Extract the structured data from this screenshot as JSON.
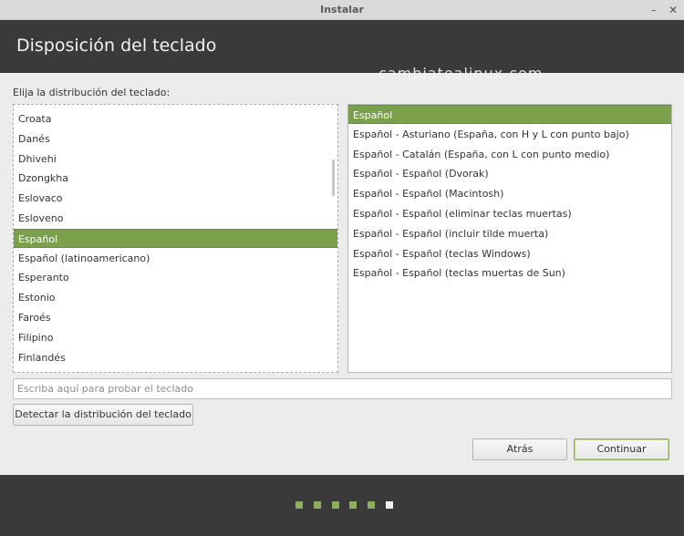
{
  "window": {
    "title": "Instalar",
    "minimize": "–",
    "close": "✕"
  },
  "header": {
    "heading": "Disposición del teclado"
  },
  "watermark": "cambiatealinux.com",
  "prompt": "Elija la distribución del teclado:",
  "layouts": {
    "items": [
      "Croata",
      "Danés",
      "Dhivehi",
      "Dzongkha",
      "Eslovaco",
      "Esloveno",
      "Español",
      "Español (latinoamericano)",
      "Esperanto",
      "Estonio",
      "Faroés",
      "Filipino",
      "Finlandés"
    ],
    "selected": "Español"
  },
  "variants": {
    "items": [
      "Español",
      "Español - Asturiano (España, con H y L con punto bajo)",
      "Español - Catalán (España, con L con punto medio)",
      "Español - Español (Dvorak)",
      "Español - Español (Macintosh)",
      "Español - Español (eliminar teclas muertas)",
      "Español - Español (incluir tilde muerta)",
      "Español - Español (teclas Windows)",
      "Español - Español (teclas muertas de Sun)"
    ],
    "selected": "Español"
  },
  "test_input": {
    "placeholder": "Escriba aquí para probar el teclado",
    "value": ""
  },
  "buttons": {
    "detect": "Detectar la distribución del teclado",
    "back": "Atrás",
    "continue": "Continuar"
  },
  "progress": {
    "total_steps": 6,
    "current_step": 6
  },
  "colors": {
    "accent": "#7aa04c",
    "header_bg": "#3a3a3a",
    "dot_done": "#8dae5d"
  }
}
